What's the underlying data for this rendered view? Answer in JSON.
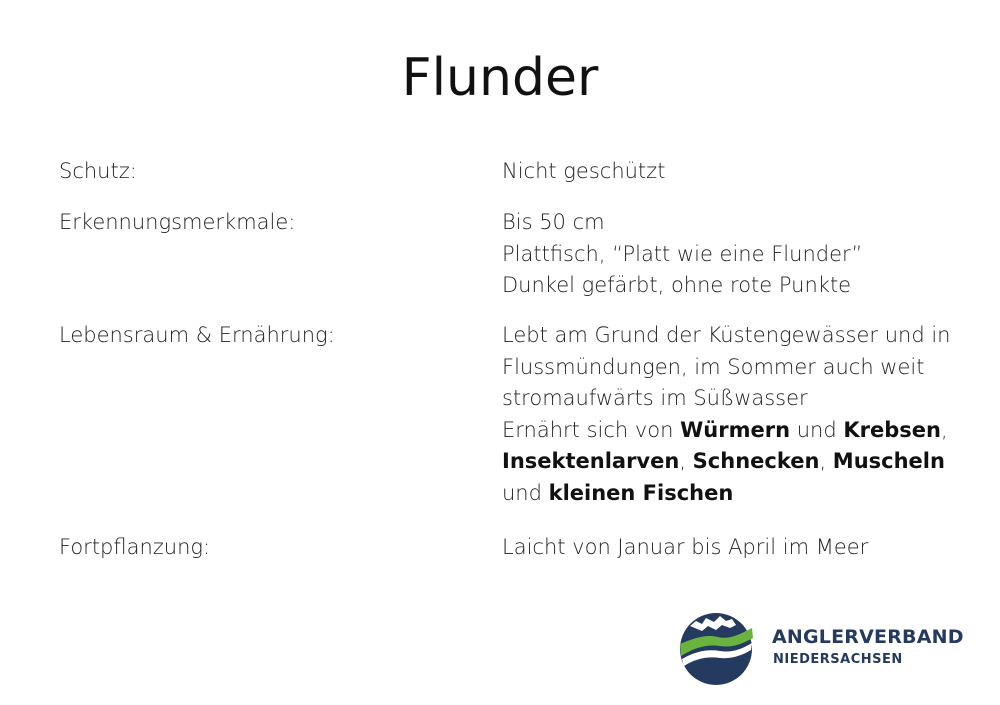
{
  "title": "Flunder",
  "rows": [
    {
      "label": "Schutz:",
      "lines": [
        [
          {
            "t": "Nicht geschützt",
            "b": false
          }
        ]
      ]
    },
    {
      "label": "Erkennungsmerkmale:",
      "lines": [
        [
          {
            "t": "Bis 50 cm",
            "b": false
          }
        ],
        [
          {
            "t": "Plattfisch, “Platt wie eine Flunder”",
            "b": false
          }
        ],
        [
          {
            "t": "Dunkel gefärbt, ohne rote Punkte",
            "b": false
          }
        ]
      ]
    },
    {
      "label": "Lebensraum & Ernährung:",
      "lines": [
        [
          {
            "t": "Lebt am Grund der Küstengewässer und in",
            "b": false
          }
        ],
        [
          {
            "t": "Flussmündungen, im Sommer auch weit",
            "b": false
          }
        ],
        [
          {
            "t": "stromaufwärts im Süßwasser",
            "b": false
          }
        ],
        [
          {
            "t": "Ernährt sich von ",
            "b": false
          },
          {
            "t": "Würmern",
            "b": true
          },
          {
            "t": " und ",
            "b": false
          },
          {
            "t": "Krebsen",
            "b": true
          },
          {
            "t": ",",
            "b": false
          }
        ],
        [
          {
            "t": "Insektenlarven",
            "b": true
          },
          {
            "t": ", ",
            "b": false
          },
          {
            "t": "Schnecken",
            "b": true
          },
          {
            "t": ", ",
            "b": false
          },
          {
            "t": "Muscheln",
            "b": true
          }
        ],
        [
          {
            "t": "und ",
            "b": false
          },
          {
            "t": "kleinen Fischen",
            "b": true
          }
        ]
      ]
    },
    {
      "label": "Fortpflanzung:",
      "lines": [
        [
          {
            "t": "Laicht von Januar bis April im Meer",
            "b": false
          }
        ]
      ]
    }
  ],
  "logo": {
    "name_line_1": "ANGLERVERBAND",
    "name_line_2": "NIEDERSACHSEN",
    "colors": {
      "navy": "#243a5e",
      "green": "#6ab33f"
    }
  }
}
